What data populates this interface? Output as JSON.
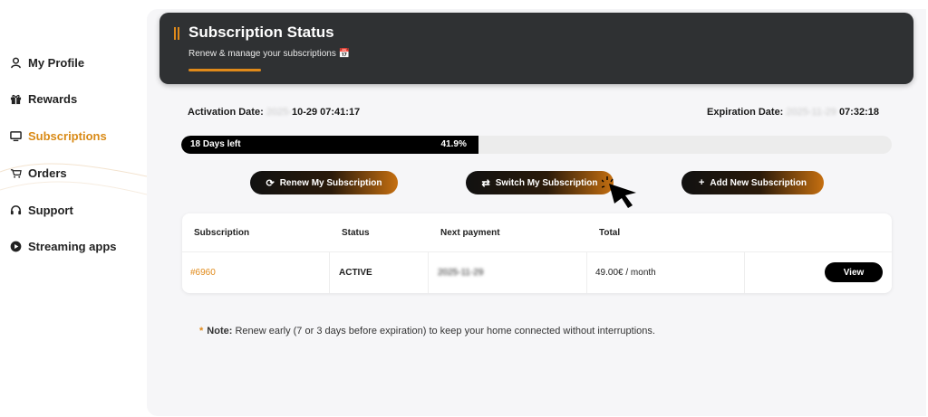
{
  "sidebar": {
    "items": [
      {
        "label": "My Profile",
        "icon": "user-icon",
        "active": false
      },
      {
        "label": "Rewards",
        "icon": "gift-icon",
        "active": false
      },
      {
        "label": "Subscriptions",
        "icon": "monitor-icon",
        "active": true
      },
      {
        "label": "Orders",
        "icon": "cart-icon",
        "active": false
      },
      {
        "label": "Support",
        "icon": "headset-icon",
        "active": false
      },
      {
        "label": "Streaming apps",
        "icon": "play-icon",
        "active": false
      }
    ]
  },
  "header": {
    "title": "Subscription Status",
    "subtitle": "Renew & manage your subscriptions 📅"
  },
  "dates": {
    "activation_label": "Activation Date:",
    "activation_year_blurred": "2025-",
    "activation_value": "10-29 07:41:17",
    "expiration_label": "Expiration Date:",
    "expiration_date_blurred": "2025-11-29",
    "expiration_value": "07:32:18"
  },
  "progress": {
    "days_left": "18 Days left",
    "percent_text": "41.9%",
    "fraction": 0.419
  },
  "actions": {
    "renew": "Renew My Subscription",
    "switch": "Switch My Subscription",
    "add": "Add New Subscription"
  },
  "table": {
    "headers": [
      "Subscription",
      "Status",
      "Next payment",
      "Total"
    ],
    "rows": [
      {
        "id": "#6960",
        "status": "ACTIVE",
        "next_payment_blurred": "2025-11-29",
        "total": "49.00€ / month",
        "action": "View"
      }
    ]
  },
  "note": {
    "star": "*",
    "bold": "Note:",
    "text": "Renew early (7 or 3 days before expiration) to keep your home connected without interruptions."
  },
  "colors": {
    "accent": "#e08a1a",
    "header_bg": "#2f3133",
    "main_bg": "#f6f6f8"
  }
}
